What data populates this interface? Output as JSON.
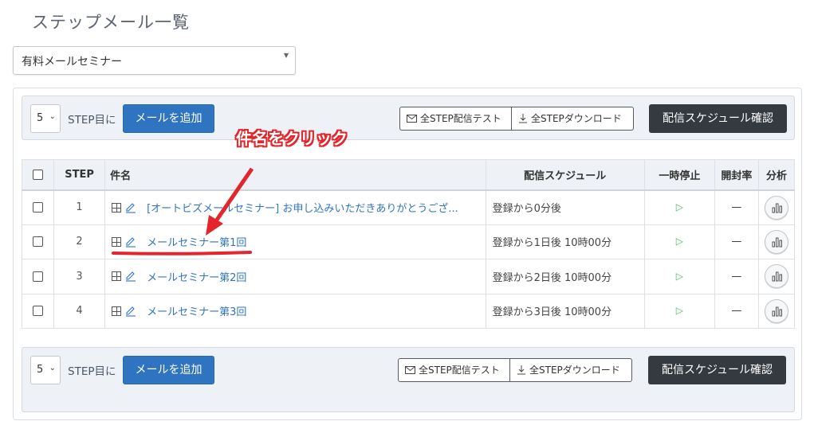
{
  "page": {
    "title": "ステップメール一覧"
  },
  "course_select": {
    "value": "有料メールセミナー"
  },
  "toolbar": {
    "step_value": "5",
    "step_suffix": "STEP目に",
    "add_label": "メールを追加",
    "test_label": "全STEP配信テスト",
    "download_label": "全STEPダウンロード",
    "schedule_label": "配信スケジュール確認"
  },
  "table": {
    "headers": {
      "step": "STEP",
      "subject": "件名",
      "schedule": "配信スケジュール",
      "pause": "一時停止",
      "open_rate": "開封率",
      "analysis": "分析"
    },
    "rows": [
      {
        "step": "1",
        "subject": "[オートビズメールセミナー] お申し込みいただきありがとうござ...",
        "schedule": "登録から0分後",
        "open_rate": "—"
      },
      {
        "step": "2",
        "subject": "メールセミナー第1回",
        "schedule": "登録から1日後 10時00分",
        "open_rate": "—"
      },
      {
        "step": "3",
        "subject": "メールセミナー第2回",
        "schedule": "登録から2日後 10時00分",
        "open_rate": "—"
      },
      {
        "step": "4",
        "subject": "メールセミナー第3回",
        "schedule": "登録から3日後 10時00分",
        "open_rate": "—"
      }
    ]
  },
  "annotation": {
    "text": "件名をクリック",
    "color": "#e3262b"
  },
  "colors": {
    "primary": "#2f74c0",
    "dark": "#343a40",
    "play": "#3bbf5b",
    "toolbar_bg": "#eef1f5"
  }
}
